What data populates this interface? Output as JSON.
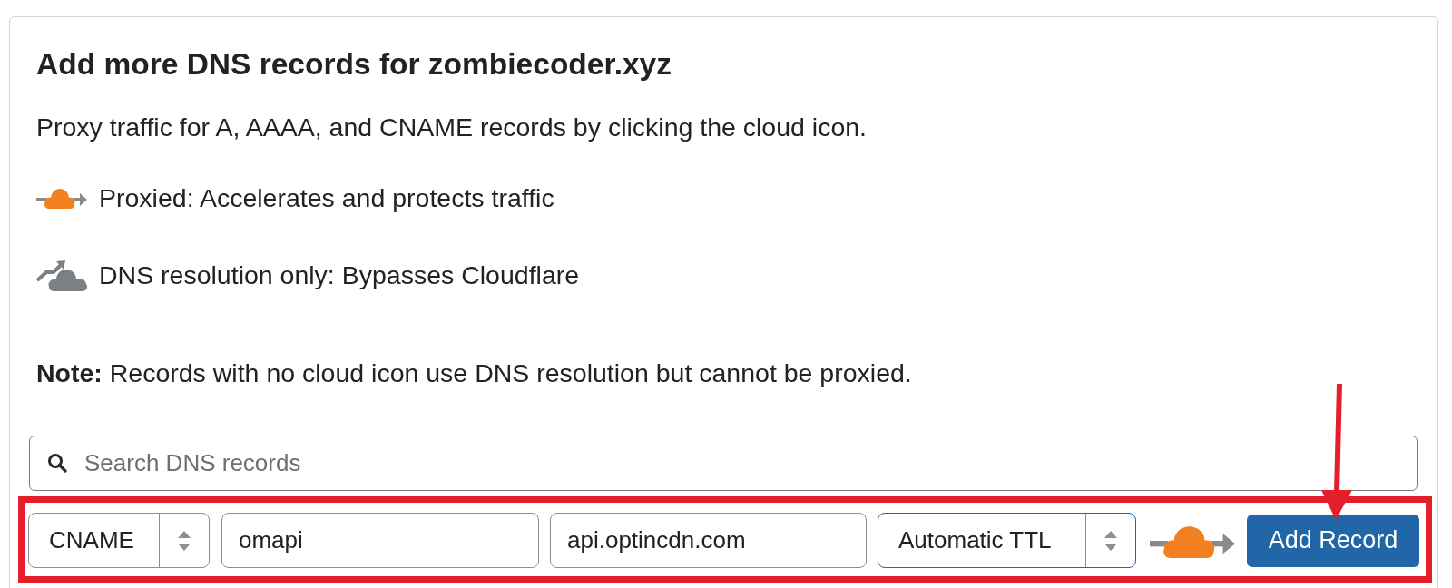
{
  "card": {
    "title": "Add more DNS records for zombiecoder.xyz",
    "intro": "Proxy traffic for A, AAAA, and CNAME records by clicking the cloud icon.",
    "legend": [
      {
        "kind": "proxied",
        "text": "Proxied: Accelerates and protects traffic"
      },
      {
        "kind": "dns_only",
        "text": "DNS resolution only: Bypasses Cloudflare"
      }
    ],
    "note": "**Note:** Records with no cloud icon use DNS resolution but cannot be proxied.",
    "search": {
      "placeholder": "Search DNS records"
    },
    "record_form": {
      "fields": [
        {
          "kind": "select",
          "value": "CNAME",
          "focused": false
        },
        {
          "kind": "input",
          "value": "omapi",
          "focused": false
        },
        {
          "kind": "input",
          "value": "api.optincdn.com",
          "focused": false
        },
        {
          "kind": "select",
          "value": "Automatic TTL",
          "focused": true
        }
      ],
      "proxied": true,
      "submit": "Add Record"
    }
  }
}
